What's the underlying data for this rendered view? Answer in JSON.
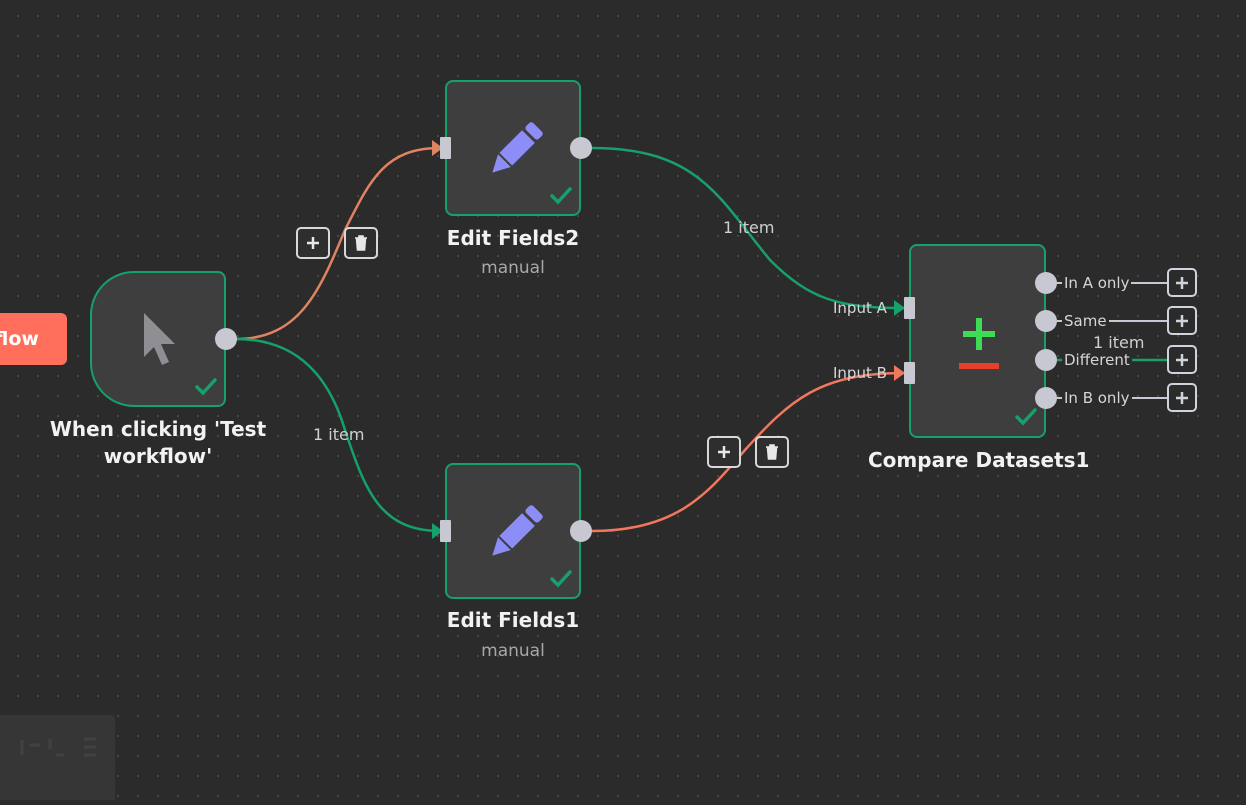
{
  "canvas": {
    "test_button_label": "flow",
    "nodes": {
      "trigger": {
        "title_line1": "When clicking 'Test",
        "title_line2": "workflow'",
        "icon": "cursor-icon",
        "status": "success-check"
      },
      "edit_fields2": {
        "title": "Edit Fields2",
        "subtitle": "manual",
        "icon": "pencil-icon",
        "status": "success-check"
      },
      "edit_fields1": {
        "title": "Edit Fields1",
        "subtitle": "manual",
        "icon": "pencil-icon",
        "status": "success-check"
      },
      "compare": {
        "title": "Compare Datasets1",
        "icon": "plus-minus-icon",
        "inputs": [
          "Input A",
          "Input B"
        ],
        "outputs": [
          "In A only",
          "Same",
          "Different",
          "In B only"
        ],
        "different_count": "1 item",
        "status": "success-check"
      }
    },
    "edges": {
      "trigger_to_edit1": "1 item",
      "edit2_to_compare": "1 item"
    }
  },
  "colors": {
    "background": "#2b2b2b",
    "node_fill": "#3e3e3f",
    "success": "#16a06a",
    "wire_active": "#16a06a",
    "wire_hover": "#e08363",
    "accent_orange": "#ff6f5c",
    "pencil": "#8c8df7",
    "plus_green": "#3ddc55",
    "minus_red": "#ea3e2d"
  }
}
